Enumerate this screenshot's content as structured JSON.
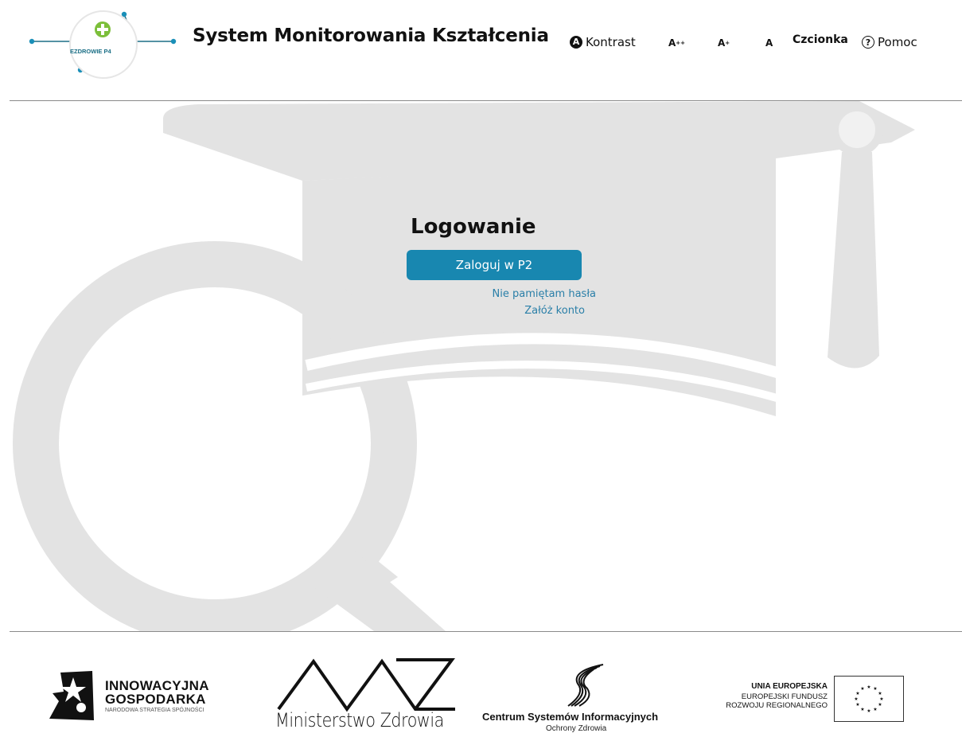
{
  "header": {
    "logo_text": "EZDROWIE P4",
    "title": "System Monitorowania Kształcenia",
    "toolbar": {
      "contrast_label": "Kontrast",
      "contrast_icon": "contrast-icon",
      "font_large": "A",
      "font_large_sup": "++",
      "font_medium": "A",
      "font_medium_sup": "+",
      "font_normal": "A",
      "font_label": "Czcionka",
      "help_label": "Pomoc",
      "help_icon": "help-circle-icon"
    }
  },
  "login": {
    "title": "Logowanie",
    "login_button": "Zaloguj w P2",
    "forgot_link": "Nie pamiętam hasła",
    "register_link": "Załóż konto",
    "button_color": "#1887b0",
    "link_color": "#2a7fa8"
  },
  "footer": {
    "innowacyjna_line1": "INNOWACYJNA",
    "innowacyjna_line2": "GOSPODARKA",
    "innowacyjna_sub": "NARODOWA STRATEGIA SPÓJNOŚCI",
    "ministerstwo": "Ministerstwo Zdrowia",
    "csioz_name": "Centrum Systemów Informacyjnych",
    "csioz_sub": "Ochrony Zdrowia",
    "ue_line1": "UNIA EUROPEJSKA",
    "ue_line2": "EUROPEJSKI FUNDUSZ",
    "ue_line3": "ROZWOJU REGIONALNEGO"
  }
}
